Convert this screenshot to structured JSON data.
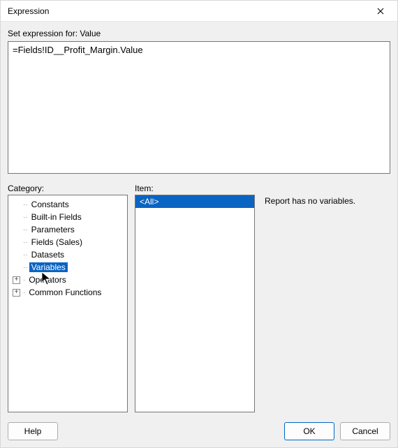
{
  "window": {
    "title": "Expression"
  },
  "setExpressionLabel": "Set expression for: Value",
  "expressionText": "=Fields!ID__Profit_Margin.Value",
  "categoryLabel": "Category:",
  "itemLabel": "Item:",
  "categories": {
    "constants": "Constants",
    "builtin": "Built-in Fields",
    "parameters": "Parameters",
    "fields": "Fields (Sales)",
    "datasets": "Datasets",
    "variables": "Variables",
    "operators": "Operators",
    "common": "Common Functions"
  },
  "items": {
    "all": "<All>"
  },
  "descriptionText": "Report has no variables.",
  "buttons": {
    "help": "Help",
    "ok": "OK",
    "cancel": "Cancel"
  }
}
